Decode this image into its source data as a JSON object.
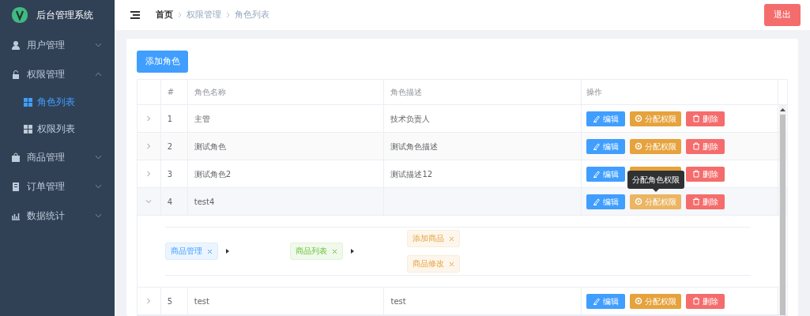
{
  "app": {
    "title": "后台管理系统"
  },
  "sidebar": {
    "items": [
      {
        "label": "用户管理",
        "expanded": false
      },
      {
        "label": "权限管理",
        "expanded": true,
        "children": [
          {
            "label": "角色列表",
            "selected": true
          },
          {
            "label": "权限列表",
            "selected": false
          }
        ]
      },
      {
        "label": "商品管理",
        "expanded": false
      },
      {
        "label": "订单管理",
        "expanded": false
      },
      {
        "label": "数据统计",
        "expanded": false
      }
    ]
  },
  "header": {
    "breadcrumb": [
      "首页",
      "权限管理",
      "角色列表"
    ],
    "logout": "退出"
  },
  "add_button": "添加角色",
  "table": {
    "columns": [
      "#",
      "角色名称",
      "角色描述",
      "操作"
    ],
    "rows": [
      {
        "index": "1",
        "name": "主管",
        "description": "技术负责人",
        "expanded": false,
        "actions": [
          {
            "kind": "edit",
            "label": "编辑",
            "hovered": false
          },
          {
            "kind": "assign",
            "label": "分配权限",
            "hovered": false
          },
          {
            "kind": "delete",
            "label": "删除",
            "hovered": false
          }
        ]
      },
      {
        "index": "2",
        "name": "测试角色",
        "description": "测试角色描述",
        "expanded": false,
        "actions": [
          {
            "kind": "edit",
            "label": "编辑",
            "hovered": false
          },
          {
            "kind": "assign",
            "label": "分配权限",
            "hovered": false
          },
          {
            "kind": "delete",
            "label": "删除",
            "hovered": false
          }
        ]
      },
      {
        "index": "3",
        "name": "测试角色2",
        "description": "测试描述12",
        "expanded": false,
        "actions": [
          {
            "kind": "edit",
            "label": "编辑",
            "hovered": false
          },
          {
            "kind": "assign",
            "hovered": false
          },
          {
            "kind": "delete",
            "label": "删除",
            "hovered": false
          }
        ]
      },
      {
        "index": "4",
        "name": "test4",
        "expanded": true,
        "actions": [
          {
            "kind": "edit",
            "label": "编辑",
            "hovered": false
          },
          {
            "kind": "assign",
            "label": "分配权限",
            "hovered": true,
            "tooltip": "分配角色权限"
          },
          {
            "kind": "delete",
            "label": "删除",
            "hovered": false
          }
        ],
        "rights": [
          {
            "label": "商品管理",
            "children": [
              {
                "label": "商品列表",
                "children": [
                  {
                    "label": "添加商品"
                  },
                  {
                    "label": "商品修改"
                  }
                ]
              }
            ]
          }
        ]
      },
      {
        "index": "5",
        "name": "test",
        "description": "test",
        "expanded": false,
        "actions": [
          {
            "kind": "edit",
            "label": "编辑",
            "hovered": false
          },
          {
            "kind": "assign",
            "label": "分配权限",
            "hovered": false
          },
          {
            "kind": "delete",
            "label": "删除",
            "hovered": false
          }
        ]
      }
    ]
  }
}
